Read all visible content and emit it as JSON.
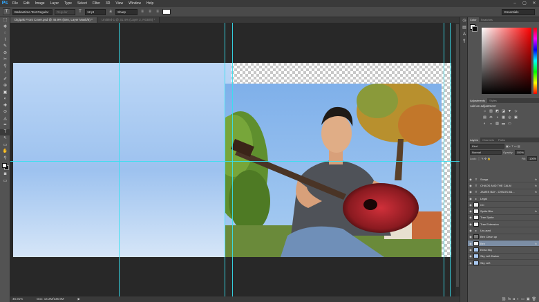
{
  "app": {
    "logo": "Ps"
  },
  "menu": [
    "File",
    "Edit",
    "Image",
    "Layer",
    "Type",
    "Select",
    "Filter",
    "3D",
    "View",
    "Window",
    "Help"
  ],
  "window_controls": [
    "–",
    "▢",
    "✕"
  ],
  "options": {
    "tool_glyph": "T",
    "font_family": "Barkantima Test Regular",
    "font_style": "Regular",
    "size_icon": "T",
    "size": "12 pt",
    "aa_icon": "a",
    "antialias": "Sharp",
    "align_icons": [
      "≡",
      "≡",
      "≡"
    ],
    "text_color": "#ffffff",
    "workspace": "Essentials"
  },
  "tools": [
    "⬚",
    "✥",
    "◌",
    "⌇",
    "✎",
    "⊘",
    "✂",
    "⚲",
    "♪",
    "✐",
    "⊕",
    "▣",
    "◐",
    "✚",
    "⊙",
    "◬",
    "✒",
    "T",
    "↖",
    "▭",
    "✋",
    "⚲"
  ],
  "documents": [
    {
      "title": "Digipak Front Cover.psd @ 46.9% (Ben, Layer Mask/8) *",
      "active": true
    },
    {
      "title": "Untitled-1 @ 31.4% (Layer 2, RGB/8) *",
      "active": false
    }
  ],
  "status": {
    "zoom": "46.91%",
    "doc": "Doc: 14.2M/135.9M",
    "arrow": "▶"
  },
  "panels": {
    "color_tabs": [
      "Color",
      "Swatches"
    ],
    "adjust_tabs": [
      "Adjustments",
      "Styles"
    ],
    "adjust_title": "Add an adjustment",
    "adjust_row1": [
      "☼",
      "▥",
      "◩",
      "◪",
      "▼",
      "◇"
    ],
    "adjust_row2": [
      "▤",
      "⚖",
      "◑",
      "▦",
      "◎",
      "▣"
    ],
    "adjust_row3": [
      "◐",
      "◒",
      "▨",
      "▬",
      "▭"
    ],
    "layer_tabs": [
      "Layers",
      "Channels",
      "Paths"
    ],
    "kind": "Kind",
    "blend": "Normal",
    "opacity_label": "Opacity:",
    "opacity": "100%",
    "lock_label": "Lock:",
    "fill_label": "Fill:",
    "fill": "100%",
    "layers": [
      {
        "name": "Songs",
        "kind": "text",
        "fx": true,
        "selected": false
      },
      {
        "name": "CHAOS AND THE CALM",
        "kind": "text",
        "fx": true,
        "selected": false
      },
      {
        "name": "JAMES BAY - CHAOS AN...",
        "kind": "text",
        "fx": true,
        "selected": false
      },
      {
        "name": "Legal",
        "kind": "folder",
        "fx": false,
        "selected": false
      },
      {
        "name": "CC",
        "kind": "image",
        "fx": false,
        "selected": false
      },
      {
        "name": "Sprite Blur",
        "kind": "image",
        "fx": true,
        "selected": false
      },
      {
        "name": "Tree Sprite",
        "kind": "image",
        "fx": false,
        "selected": false
      },
      {
        "name": "Tree Extension",
        "kind": "image",
        "fx": false,
        "selected": false
      },
      {
        "name": "Un-used",
        "kind": "folder",
        "fx": false,
        "selected": false
      },
      {
        "name": "Ben Clean up",
        "kind": "dark",
        "fx": false,
        "selected": false
      },
      {
        "name": "Ben",
        "kind": "image",
        "fx": true,
        "selected": true
      },
      {
        "name": "Extra Sky",
        "kind": "sky",
        "fx": false,
        "selected": false
      },
      {
        "name": "Sky Left Darker",
        "kind": "sky",
        "fx": false,
        "selected": false
      },
      {
        "name": "Sky Left",
        "kind": "sky",
        "fx": false,
        "selected": false
      }
    ],
    "footer_icons": [
      "⛓",
      "fx",
      "◘",
      "◐",
      "▭",
      "▣",
      "🗑"
    ]
  }
}
